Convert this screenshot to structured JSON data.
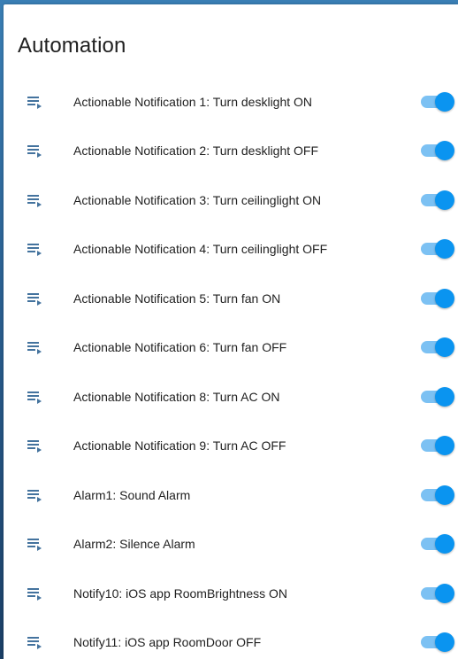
{
  "card": {
    "title": "Automation"
  },
  "colors": {
    "icon": "#44739e",
    "toggle_track": "#7cc1f3",
    "toggle_thumb": "#0a94f0"
  },
  "automations": [
    {
      "label": "Actionable Notification 1: Turn desklight ON",
      "icon": "playlist-play-icon",
      "enabled": true
    },
    {
      "label": "Actionable Notification 2: Turn desklight OFF",
      "icon": "playlist-play-icon",
      "enabled": true
    },
    {
      "label": "Actionable Notification 3: Turn ceilinglight ON",
      "icon": "playlist-play-icon",
      "enabled": true
    },
    {
      "label": "Actionable Notification 4: Turn ceilinglight OFF",
      "icon": "playlist-play-icon",
      "enabled": true
    },
    {
      "label": "Actionable Notification 5: Turn fan ON",
      "icon": "playlist-play-icon",
      "enabled": true
    },
    {
      "label": "Actionable Notification 6: Turn fan OFF",
      "icon": "playlist-play-icon",
      "enabled": true
    },
    {
      "label": "Actionable Notification 8: Turn AC ON",
      "icon": "playlist-play-icon",
      "enabled": true
    },
    {
      "label": "Actionable Notification 9: Turn AC OFF",
      "icon": "playlist-play-icon",
      "enabled": true
    },
    {
      "label": "Alarm1: Sound Alarm",
      "icon": "playlist-play-icon",
      "enabled": true
    },
    {
      "label": "Alarm2: Silence Alarm",
      "icon": "playlist-play-icon",
      "enabled": true
    },
    {
      "label": "Notify10: iOS app RoomBrightness ON",
      "icon": "playlist-play-icon",
      "enabled": true
    },
    {
      "label": "Notify11: iOS app RoomDoor OFF",
      "icon": "playlist-play-icon",
      "enabled": true
    }
  ]
}
